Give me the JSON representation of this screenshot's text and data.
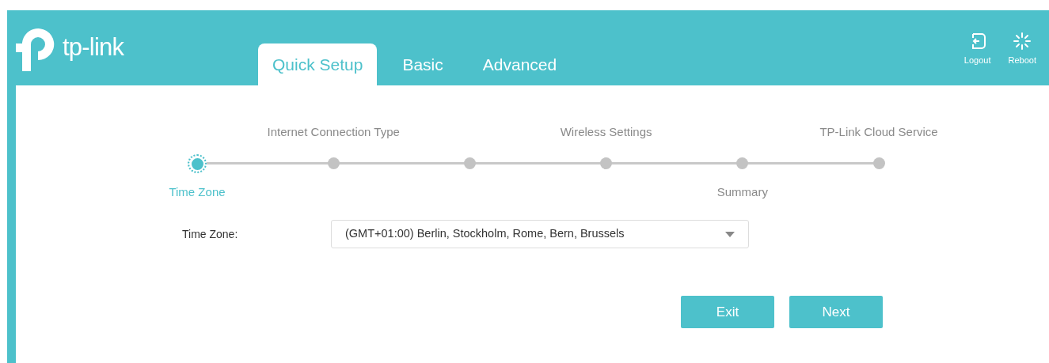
{
  "header": {
    "brand": "tp-link",
    "tabs": [
      {
        "label": "Quick Setup",
        "selected": true
      },
      {
        "label": "Basic",
        "selected": false
      },
      {
        "label": "Advanced",
        "selected": false
      }
    ],
    "actions": [
      {
        "kind": "logout",
        "label": "Logout"
      },
      {
        "kind": "reboot",
        "label": "Reboot"
      }
    ]
  },
  "steps": [
    {
      "label": "Time Zone",
      "label_below": true,
      "selected": true
    },
    {
      "label": "Internet Connection Type",
      "label_below": false,
      "selected": false
    },
    {
      "selected": false
    },
    {
      "label": "Wireless Settings",
      "label_below": false,
      "selected": false
    },
    {
      "label": "Summary",
      "label_below": true,
      "selected": false
    },
    {
      "label": "TP-Link Cloud Service",
      "label_below": false,
      "selected": false
    }
  ],
  "form": {
    "label": "Time Zone:",
    "value": "(GMT+01:00) Berlin, Stockholm, Rome, Bern, Brussels"
  },
  "buttons": [
    "Exit",
    "Next"
  ]
}
